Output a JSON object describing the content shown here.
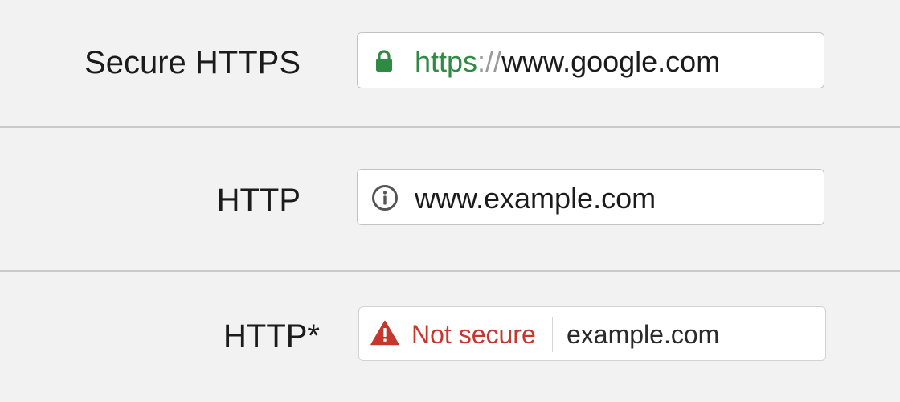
{
  "rows": [
    {
      "label": "Secure HTTPS",
      "icon": "lock-icon",
      "url_scheme": "https",
      "url_separator": "://",
      "url_host": "www.google.com"
    },
    {
      "label": "HTTP",
      "icon": "info-icon",
      "url": "www.example.com"
    },
    {
      "label": "HTTP*",
      "icon": "warning-icon",
      "status_text": "Not secure",
      "url": "example.com"
    }
  ],
  "colors": {
    "background": "#f2f2f2",
    "secure_green": "#2f8a43",
    "warning_red": "#c5372c",
    "info_gray": "#555555"
  }
}
